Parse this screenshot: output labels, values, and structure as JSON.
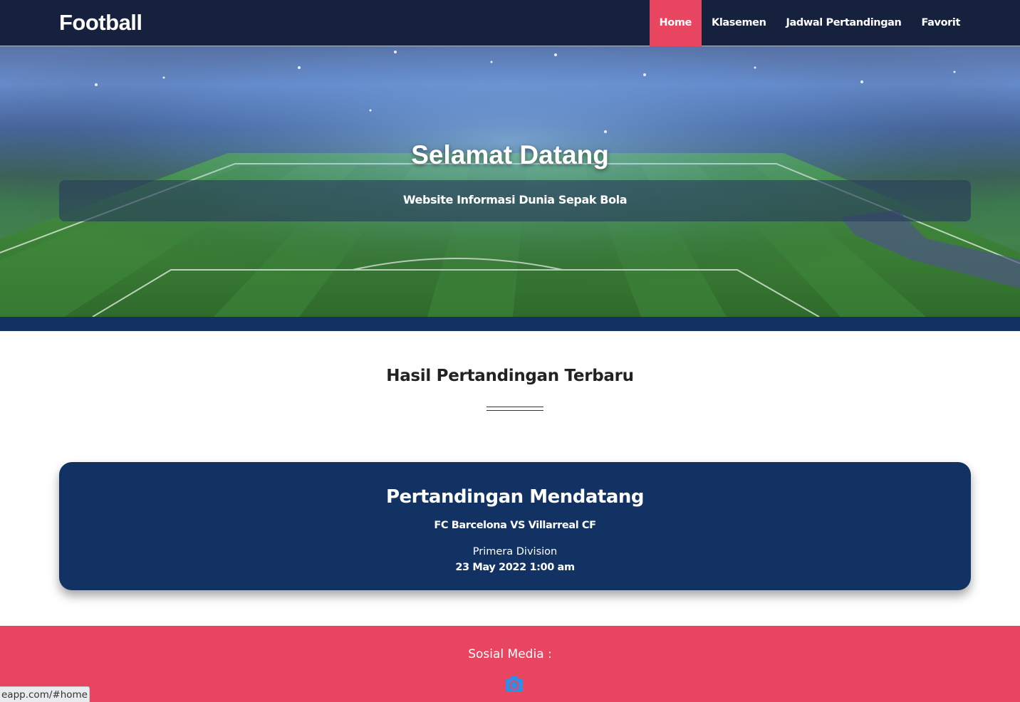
{
  "navbar": {
    "brand": "Football",
    "items": [
      {
        "label": "Home",
        "active": true
      },
      {
        "label": "Klasemen",
        "active": false
      },
      {
        "label": "Jadwal Pertandingan",
        "active": false
      },
      {
        "label": "Favorit",
        "active": false
      }
    ]
  },
  "hero": {
    "title": "Selamat Datang",
    "subtitle": "Website Informasi Dunia Sepak Bola",
    "background": "stadium-image"
  },
  "results": {
    "title": "Hasil Pertandingan Terbaru"
  },
  "match_card": {
    "title": "Pertandingan Mendatang",
    "teams": "FC Barcelona VS Villarreal CF",
    "league": "Primera Division",
    "datetime": "23 May 2022 1:00 am"
  },
  "footer": {
    "title": "Sosial Media :",
    "icons": [
      "instagram-icon"
    ]
  },
  "status_bar": {
    "url": "eapp.com/#home"
  },
  "colors": {
    "navbar": "#16213e",
    "accent": "#e84560",
    "card": "#123263",
    "stripe": "#123263",
    "instagram_icon": "#2f8fe6"
  }
}
